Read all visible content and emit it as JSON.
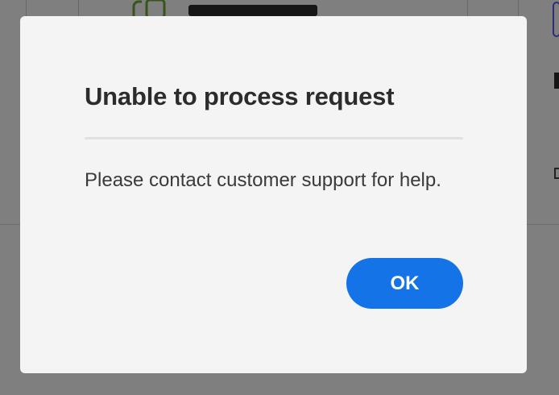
{
  "background": {
    "colors": {
      "app_icon_green": "#6ea83a",
      "accent_purple": "#5c5ce0"
    }
  },
  "dialog": {
    "title": "Unable to process request",
    "message": "Please contact customer support for help.",
    "ok_label": "OK",
    "colors": {
      "background": "#f4f4f4",
      "button": "#1473e6",
      "button_text": "#ffffff",
      "title_text": "#2c2c2c"
    }
  }
}
